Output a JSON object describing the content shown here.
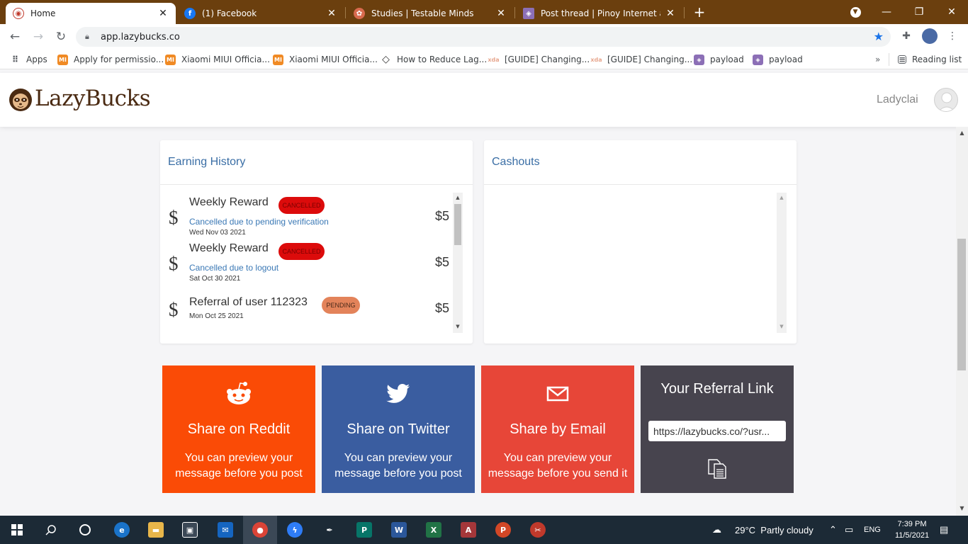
{
  "browser": {
    "tabs": [
      {
        "title": "Home",
        "active": true,
        "favicon": "lazybucks-icon"
      },
      {
        "title": "(1) Facebook",
        "active": false,
        "favicon": "facebook-icon"
      },
      {
        "title": "Studies | Testable Minds",
        "active": false,
        "favicon": "testable-icon"
      },
      {
        "title": "Post thread | Pinoy Internet and",
        "active": false,
        "favicon": "pinoy-icon"
      }
    ],
    "url": "app.lazybucks.co",
    "bookmarks": [
      {
        "label": "Apps",
        "icon": "apps-grid-icon"
      },
      {
        "label": "Apply for permissio...",
        "icon": "miui-icon"
      },
      {
        "label": "Xiaomi MIUI Officia...",
        "icon": "miui-icon"
      },
      {
        "label": "Xiaomi MIUI Officia...",
        "icon": "miui-icon"
      },
      {
        "label": "How to Reduce Lag...",
        "icon": "diamond-icon"
      },
      {
        "label": "[GUIDE] Changing...",
        "icon": "xda-icon"
      },
      {
        "label": "[GUIDE] Changing...",
        "icon": "xda-icon"
      },
      {
        "label": "payload",
        "icon": "cube-icon"
      },
      {
        "label": "payload",
        "icon": "cube-icon"
      }
    ],
    "reading_list": "Reading list"
  },
  "site": {
    "logo_text": "LazyBucks",
    "username": "Ladyclai"
  },
  "earning_history": {
    "title": "Earning History",
    "entries": [
      {
        "title": "Weekly Reward",
        "badge": "CANCELLED",
        "reason": "Cancelled due to pending verification",
        "date": "Wed Nov 03 2021",
        "amount": "$5"
      },
      {
        "title": "Weekly Reward",
        "badge": "CANCELLED",
        "reason": "Cancelled due to logout",
        "date": "Sat Oct 30 2021",
        "amount": "$5"
      },
      {
        "title": "Referral of user 112323",
        "badge": "PENDING",
        "reason": "",
        "date": "Mon Oct 25 2021",
        "amount": "$5"
      }
    ]
  },
  "cashouts": {
    "title": "Cashouts"
  },
  "share": {
    "reddit": {
      "heading": "Share on Reddit",
      "desc": "You can preview your message before you post"
    },
    "twitter": {
      "heading": "Share on Twitter",
      "desc": "You can preview your message before you post"
    },
    "email": {
      "heading": "Share by Email",
      "desc": "You can preview your message before you send it"
    },
    "referral": {
      "heading": "Your Referral Link",
      "link": "https://lazybucks.co/?usr..."
    }
  },
  "taskbar": {
    "weather_temp": "29°C",
    "weather_desc": "Partly cloudy",
    "language": "ENG",
    "time": "7:39 PM",
    "date": "11/5/2021"
  },
  "colors": {
    "reddit": "#fa4b06",
    "twitter": "#3a5da0",
    "email": "#e74638",
    "referral": "#47444e",
    "cancelled_badge": "#dc0b0b",
    "pending_badge": "#e3835a",
    "tab_strip": "#6b3f0e"
  }
}
